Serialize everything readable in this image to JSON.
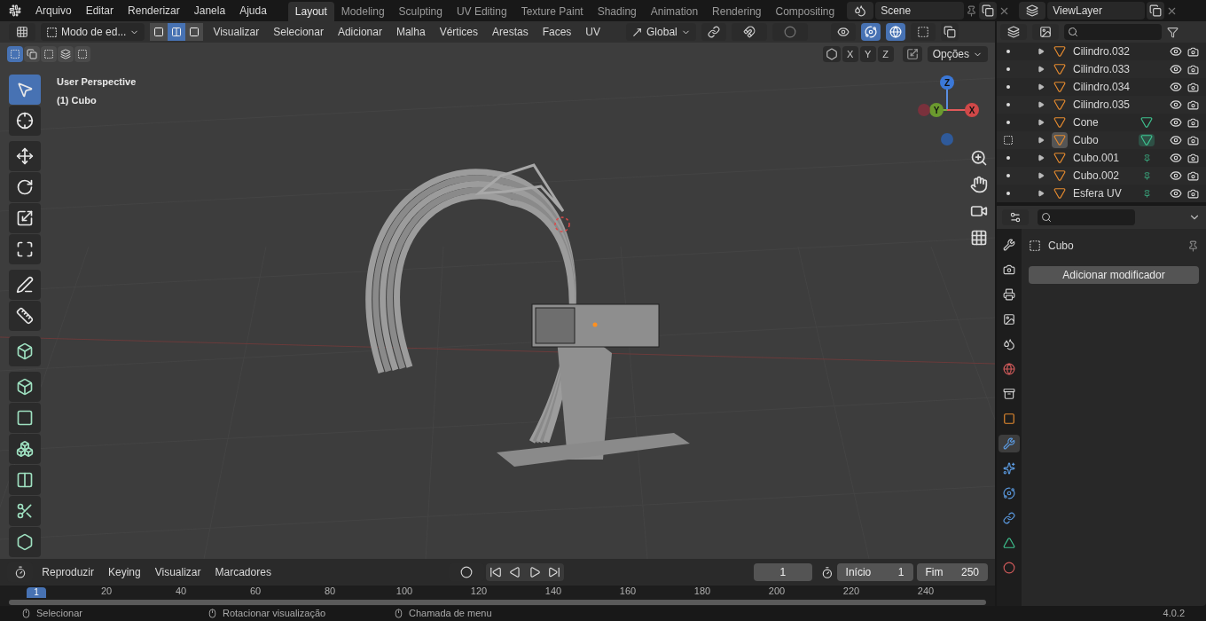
{
  "top_menu": [
    "Arquivo",
    "Editar",
    "Renderizar",
    "Janela",
    "Ajuda"
  ],
  "workspaces": [
    {
      "label": "Layout",
      "selected": true
    },
    {
      "label": "Modeling",
      "selected": false
    },
    {
      "label": "Sculpting",
      "selected": false
    },
    {
      "label": "UV Editing",
      "selected": false
    },
    {
      "label": "Texture Paint",
      "selected": false
    },
    {
      "label": "Shading",
      "selected": false
    },
    {
      "label": "Animation",
      "selected": false
    },
    {
      "label": "Rendering",
      "selected": false
    },
    {
      "label": "Compositing",
      "selected": false
    }
  ],
  "scene": "Scene",
  "view_layer": "ViewLayer",
  "header": {
    "mode": "Modo de ed...",
    "select_modes": [
      {
        "kind": "vertex",
        "selected": false
      },
      {
        "kind": "edge",
        "selected": true
      },
      {
        "kind": "face",
        "selected": false
      }
    ],
    "menus": [
      "Visualizar",
      "Selecionar",
      "Adicionar",
      "Malha",
      "Vértices",
      "Arestas",
      "Faces",
      "UV"
    ],
    "orientation": "Global"
  },
  "select_box_modes": [
    {
      "kind": "new",
      "selected": true
    },
    {
      "kind": "extend",
      "selected": false
    },
    {
      "kind": "subtract",
      "selected": false
    },
    {
      "kind": "invert",
      "selected": false
    },
    {
      "kind": "intersect",
      "selected": false
    }
  ],
  "viewport": {
    "perspective": "User Perspective",
    "object": "(1) Cubo",
    "axis_toggles": [
      "X",
      "Y",
      "Z"
    ],
    "options": "Opções",
    "gizmo": {
      "z": "Z",
      "y": "Y",
      "x": "X"
    }
  },
  "tool_groups": [
    [
      {
        "kind": "select",
        "selected": true
      },
      {
        "kind": "cursor",
        "selected": false
      }
    ],
    [
      {
        "kind": "move",
        "selected": false
      },
      {
        "kind": "rotate",
        "selected": false
      },
      {
        "kind": "scale",
        "selected": false
      },
      {
        "kind": "transform",
        "selected": false
      }
    ],
    [
      {
        "kind": "annotate",
        "selected": false
      },
      {
        "kind": "measure",
        "selected": false
      }
    ],
    [
      {
        "kind": "add_cube",
        "selected": false
      }
    ],
    [
      {
        "kind": "extrude",
        "selected": false
      },
      {
        "kind": "inset",
        "selected": false
      },
      {
        "kind": "bevel",
        "selected": false
      },
      {
        "kind": "loop_cut",
        "selected": false
      },
      {
        "kind": "knife",
        "selected": false
      },
      {
        "kind": "poly_build",
        "selected": false
      }
    ]
  ],
  "outliner": {
    "items": [
      {
        "name": "Cilindro.032",
        "active": false
      },
      {
        "name": "Cilindro.033",
        "active": false
      },
      {
        "name": "Cilindro.034",
        "active": false
      },
      {
        "name": "Cilindro.035",
        "active": false
      },
      {
        "name": "Cone",
        "active": false,
        "kind": "mesh_data"
      },
      {
        "name": "Cubo",
        "active": true,
        "kind": "mesh_data"
      },
      {
        "name": "Cubo.001",
        "active": false,
        "kind": "pinned"
      },
      {
        "name": "Cubo.002",
        "active": false,
        "kind": "pinned"
      },
      {
        "name": "Esfera UV",
        "active": false,
        "kind": "pinned"
      }
    ]
  },
  "properties": {
    "object": "Cubo",
    "add_modifier": "Adicionar modificador",
    "tabs": [
      {
        "kind": "tool",
        "selected": false
      },
      {
        "kind": "render",
        "selected": false
      },
      {
        "kind": "output",
        "selected": false
      },
      {
        "kind": "view_layer",
        "selected": false
      },
      {
        "kind": "scene",
        "selected": false
      },
      {
        "kind": "world",
        "selected": false
      },
      {
        "kind": "collection",
        "selected": false
      },
      {
        "kind": "object",
        "selected": false
      },
      {
        "kind": "modifier",
        "selected": true
      },
      {
        "kind": "particles",
        "selected": false
      },
      {
        "kind": "physics",
        "selected": false
      },
      {
        "kind": "constraints",
        "selected": false
      },
      {
        "kind": "data",
        "selected": false
      },
      {
        "kind": "material",
        "selected": false
      }
    ]
  },
  "timeline": {
    "menus": [
      "Reproduzir",
      "Keying",
      "Visualizar",
      "Marcadores"
    ],
    "current_frame": "1",
    "start_label": "Início",
    "start": "1",
    "end_label": "Fim",
    "end": "250",
    "marker": "1",
    "ticks": [
      "20",
      "40",
      "60",
      "80",
      "100",
      "120",
      "140",
      "160",
      "180",
      "200",
      "220",
      "240"
    ]
  },
  "status_bar": {
    "hints": [
      "Selecionar",
      "Rotacionar visualização",
      "Chamada de menu"
    ],
    "version": "4.0.2"
  }
}
